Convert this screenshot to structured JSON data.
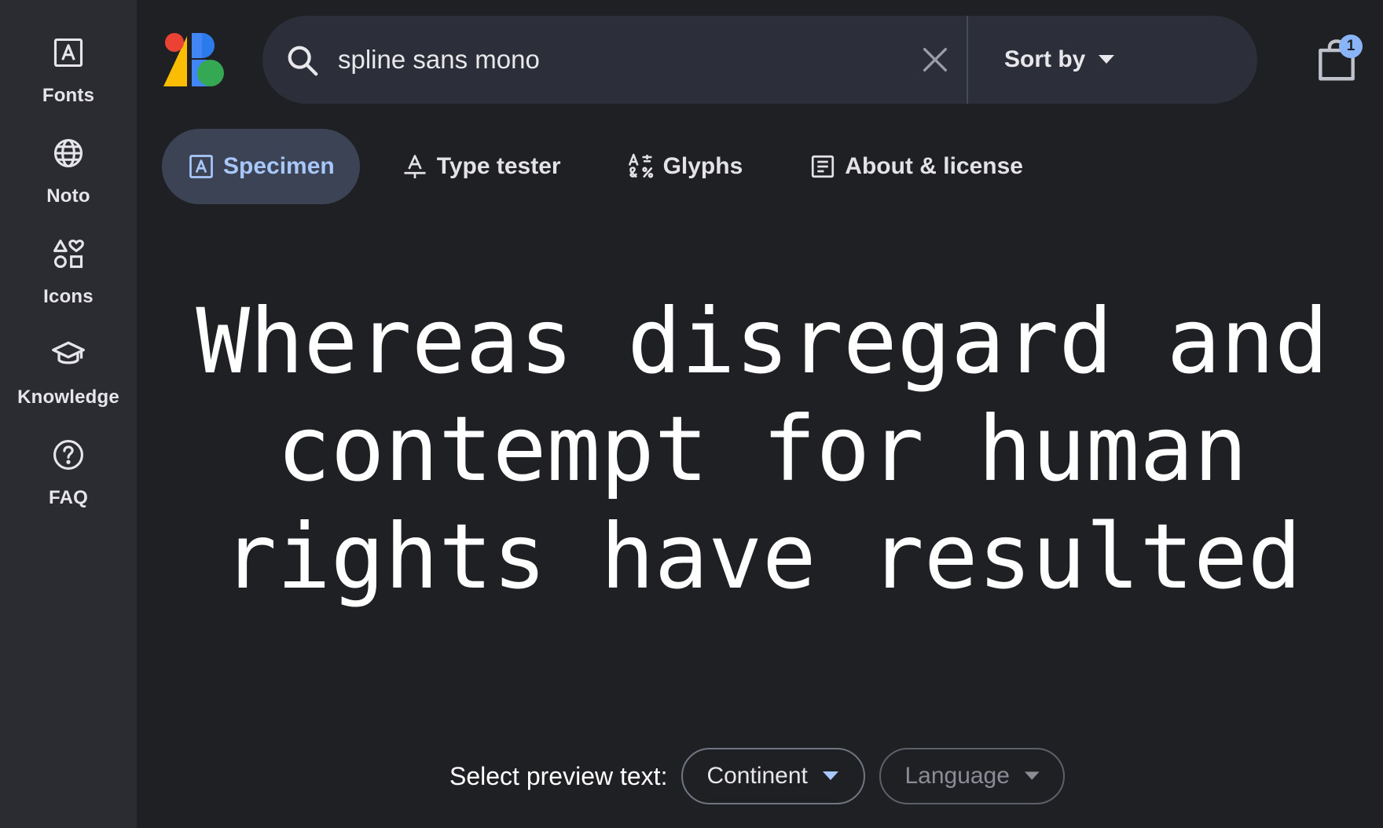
{
  "rail": {
    "items": [
      {
        "label": "Fonts",
        "icon": "font-a-icon"
      },
      {
        "label": "Noto",
        "icon": "globe-icon"
      },
      {
        "label": "Icons",
        "icon": "shapes-icon"
      },
      {
        "label": "Knowledge",
        "icon": "graduation-cap-icon"
      },
      {
        "label": "FAQ",
        "icon": "help-circle-icon"
      }
    ]
  },
  "header": {
    "logo": "google-fonts-logo",
    "search": {
      "value": "spline sans mono"
    },
    "sort_label": "Sort by",
    "cart_count": "1"
  },
  "tabs": [
    {
      "label": "Specimen",
      "active": true
    },
    {
      "label": "Type tester",
      "active": false
    },
    {
      "label": "Glyphs",
      "active": false
    },
    {
      "label": "About & license",
      "active": false
    }
  ],
  "specimen": {
    "text": "Whereas disregard and\ncontempt for human\nrights have resulted"
  },
  "preview": {
    "label": "Select preview text:",
    "continent": "Continent",
    "language": "Language"
  },
  "colors": {
    "background": "#1f2024",
    "rail": "#2b2c31",
    "search": "#2c2f39",
    "active_tab": "#3c4354",
    "accent": "#a8c7fa",
    "badge": "#8ab4f8"
  }
}
